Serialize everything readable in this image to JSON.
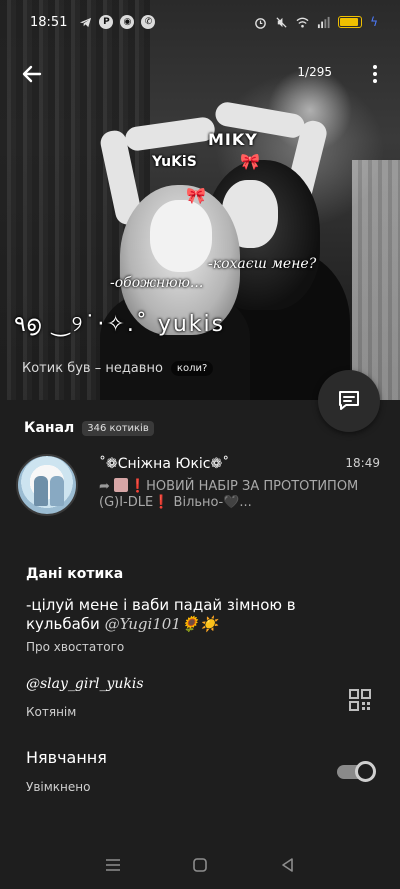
{
  "status_bar": {
    "time": "18:51",
    "battery_level": 0.8
  },
  "header": {
    "counter": "1/295"
  },
  "photo": {
    "overlay_miky": "MIKY",
    "overlay_yukis": "YuKiS",
    "overlay_love": "-кохаєш мене?",
    "overlay_adore": "-обожнюю...",
    "overlay_deco": "٩൭ ‿୨˙·✧.˚ yukis",
    "status_text": "Котик був – недавно",
    "when_chip": "коли?"
  },
  "channel": {
    "title": "Канал",
    "count": "346 котиків",
    "name": "˚❁Сніжна Юкіс❁˚",
    "time": "18:49",
    "preview_main": "НОВИЙ НАБІР ЗА ПРОТОТИПОМ (G)I-DLE",
    "preview_tail": "Вільно-🖤..."
  },
  "info": {
    "section_title": "Дані котика",
    "bio": "-цілуй мене і ваби падай зімною в кульбаби",
    "bio_mention": "@Yugi101🌻☀️",
    "bio_label": "Про хвостатого",
    "username": "@slay_girl_yukis",
    "username_label": "Котянім",
    "notifications_title": "Нявчання",
    "notifications_value": "Увімкнено"
  }
}
